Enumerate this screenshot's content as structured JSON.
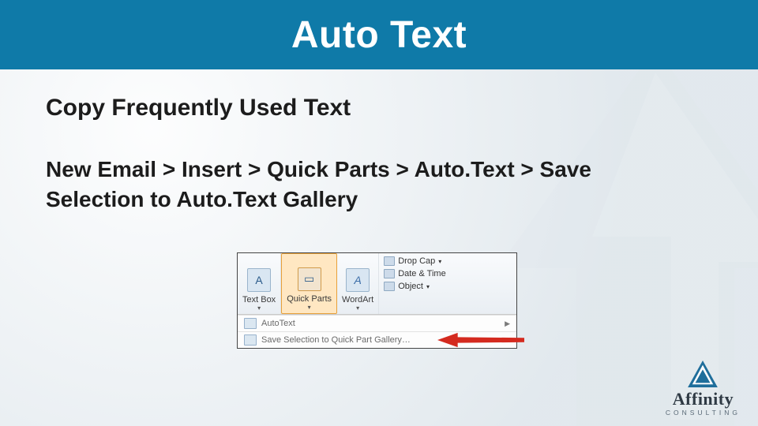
{
  "title": "Auto Text",
  "subtitle": "Copy Frequently Used Text",
  "breadcrumb_path": "New Email > Insert > Quick Parts > Auto.Text > Save Selection to Auto.Text Gallery",
  "ribbon": {
    "items": [
      {
        "label": "Text Box",
        "glyph": "A"
      },
      {
        "label": "Quick Parts",
        "glyph": "▭"
      },
      {
        "label": "WordArt",
        "glyph": "A"
      }
    ],
    "small_items": [
      {
        "label": "Drop Cap",
        "glyph": "A"
      },
      {
        "label": "Date & Time"
      },
      {
        "label": "Object"
      }
    ],
    "menu": [
      {
        "label": "AutoText"
      },
      {
        "label": "Save Selection to Quick Part Gallery…"
      }
    ]
  },
  "brand": {
    "name": "Affinity",
    "sub": "CONSULTING"
  },
  "colors": {
    "title_bg": "#0f7aa8",
    "accent_arrow": "#d42a1f"
  }
}
